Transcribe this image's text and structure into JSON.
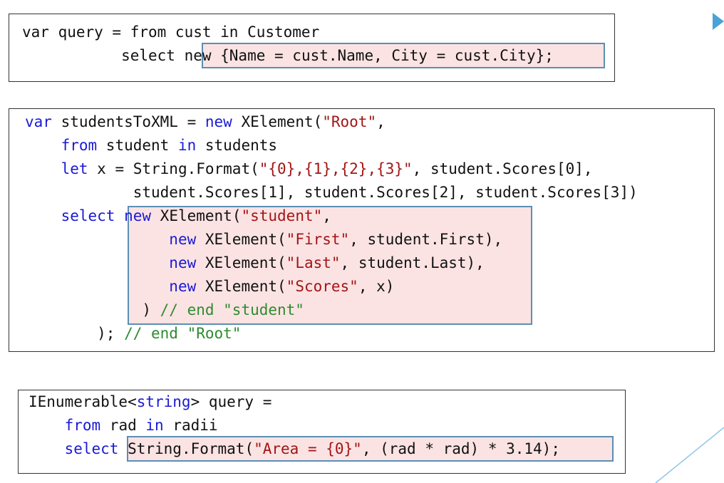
{
  "snippet1": {
    "line1": [
      {
        "t": "var query = from cust in Customer",
        "c": ""
      }
    ],
    "line2": [
      {
        "t": "           select ",
        "c": ""
      },
      {
        "t": "new {Name = cust.Name, City = cust.City};",
        "c": ""
      }
    ]
  },
  "snippet2": {
    "lines": [
      [
        {
          "t": "var",
          "c": "kw"
        },
        {
          "t": " studentsToXML = ",
          "c": ""
        },
        {
          "t": "new",
          "c": "kw"
        },
        {
          "t": " XElement(",
          "c": ""
        },
        {
          "t": "\"Root\"",
          "c": "str"
        },
        {
          "t": ",",
          "c": ""
        }
      ],
      [
        {
          "t": "    ",
          "c": ""
        },
        {
          "t": "from",
          "c": "kw"
        },
        {
          "t": " student ",
          "c": ""
        },
        {
          "t": "in",
          "c": "kw"
        },
        {
          "t": " students",
          "c": ""
        }
      ],
      [
        {
          "t": "    ",
          "c": ""
        },
        {
          "t": "let",
          "c": "kw"
        },
        {
          "t": " x = String.Format(",
          "c": ""
        },
        {
          "t": "\"{0},{1},{2},{3}\"",
          "c": "str"
        },
        {
          "t": ", student.Scores[0],",
          "c": ""
        }
      ],
      [
        {
          "t": "            student.Scores[1], student.Scores[2], student.Scores[3])",
          "c": ""
        }
      ],
      [
        {
          "t": "    ",
          "c": ""
        },
        {
          "t": "select",
          "c": "kw"
        },
        {
          "t": " ",
          "c": ""
        },
        {
          "t": "new",
          "c": "kw"
        },
        {
          "t": " XElement(",
          "c": ""
        },
        {
          "t": "\"student\"",
          "c": "str"
        },
        {
          "t": ",",
          "c": ""
        }
      ],
      [
        {
          "t": "                ",
          "c": ""
        },
        {
          "t": "new",
          "c": "kw"
        },
        {
          "t": " XElement(",
          "c": ""
        },
        {
          "t": "\"First\"",
          "c": "str"
        },
        {
          "t": ", student.First),",
          "c": ""
        }
      ],
      [
        {
          "t": "                ",
          "c": ""
        },
        {
          "t": "new",
          "c": "kw"
        },
        {
          "t": " XElement(",
          "c": ""
        },
        {
          "t": "\"Last\"",
          "c": "str"
        },
        {
          "t": ", student.Last),",
          "c": ""
        }
      ],
      [
        {
          "t": "                ",
          "c": ""
        },
        {
          "t": "new",
          "c": "kw"
        },
        {
          "t": " XElement(",
          "c": ""
        },
        {
          "t": "\"Scores\"",
          "c": "str"
        },
        {
          "t": ", x)",
          "c": ""
        }
      ],
      [
        {
          "t": "             ) ",
          "c": ""
        },
        {
          "t": "// end \"student\"",
          "c": "cm"
        }
      ],
      [
        {
          "t": "        ); ",
          "c": ""
        },
        {
          "t": "// end \"Root\"",
          "c": "cm"
        }
      ]
    ]
  },
  "snippet3": {
    "lines": [
      [
        {
          "t": "IEnumerable<",
          "c": ""
        },
        {
          "t": "string",
          "c": "kw"
        },
        {
          "t": "> query =",
          "c": ""
        }
      ],
      [
        {
          "t": "    ",
          "c": ""
        },
        {
          "t": "from",
          "c": "kw"
        },
        {
          "t": " rad ",
          "c": ""
        },
        {
          "t": "in",
          "c": "kw"
        },
        {
          "t": " radii",
          "c": ""
        }
      ],
      [
        {
          "t": "    ",
          "c": ""
        },
        {
          "t": "select",
          "c": "kw"
        },
        {
          "t": " String.Format(",
          "c": ""
        },
        {
          "t": "\"Area = {0}\"",
          "c": "str"
        },
        {
          "t": ", (rad * rad) * 3.14);",
          "c": ""
        }
      ]
    ]
  },
  "colors": {
    "keyword": "#1a1ad6",
    "string": "#a31515",
    "comment": "#2e8b2e",
    "highlight_fill": "#fbe3e3",
    "highlight_border": "#5b8fb3"
  }
}
